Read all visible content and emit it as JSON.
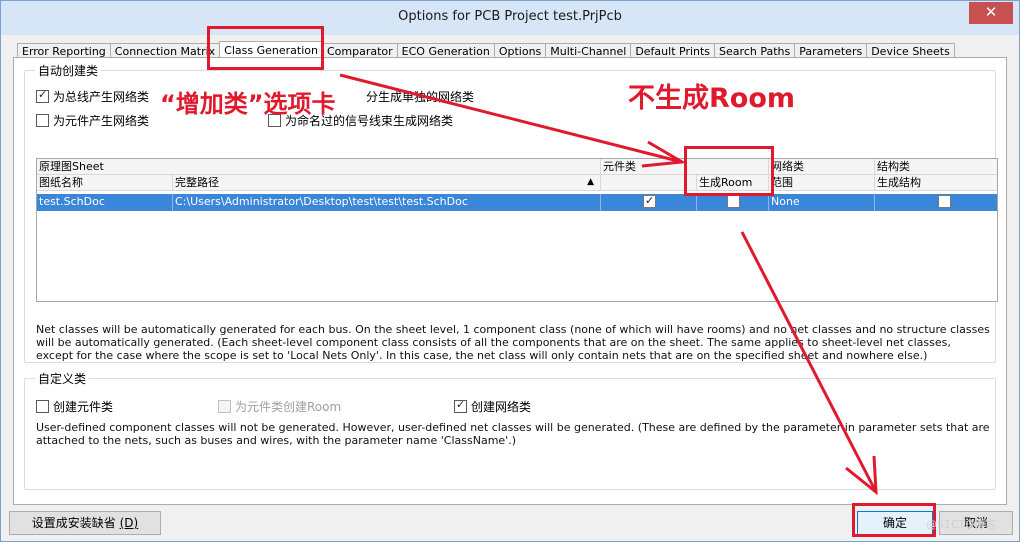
{
  "window": {
    "title": "Options for PCB Project test.PrjPcb",
    "close_glyph": "✕"
  },
  "tabs": [
    "Error Reporting",
    "Connection Matrix",
    "Class Generation",
    "Comparator",
    "ECO Generation",
    "Options",
    "Multi-Channel",
    "Default Prints",
    "Search Paths",
    "Parameters",
    "Device Sheets"
  ],
  "auto_group": {
    "title": "自动创建类",
    "cb_bus": "为总线产生网络类",
    "cb_bus_partial": "分生成单独的网络类",
    "cb_component": "为元件产生网络类",
    "cb_named": "为命名过的信号线束生成网络类",
    "grid": {
      "h1_sheet": "原理图Sheet",
      "h1_component_class": "元件类",
      "h1_net_class": "网络类",
      "h1_structure_class": "结构类",
      "h2_sheet_name": "图纸名称",
      "h2_full_path": "完整路径",
      "h2_sort_arrow": "▲",
      "h2_generate_room": "生成Room",
      "h2_scope": "范围",
      "h2_generate_structure": "生成结构",
      "row": {
        "sheet_name": "test.SchDoc",
        "full_path": "C:\\Users\\Administrator\\Desktop\\test\\test\\test.SchDoc",
        "scope": "None"
      }
    },
    "description": "Net classes will be automatically generated for each bus. On the sheet level, 1 component class (none of which will have rooms) and no net classes and no structure classes will be automatically generated. (Each sheet-level component class consists of all the components that are on the sheet. The same applies to sheet-level net classes, except for the case where the scope is set to 'Local Nets Only'. In this case, the net class will only contain nets that are on the specified sheet and nowhere else.)"
  },
  "custom_group": {
    "title": "自定义类",
    "cb_create_component": "创建元件类",
    "cb_create_room": "为元件类创建Room",
    "cb_create_net": "创建网络类",
    "description": "User-defined component classes will not be generated. However, user-defined net classes will be generated. (These are defined by the parameter in parameter sets that are attached to the nets, such as buses and wires, with the parameter name 'ClassName'.)"
  },
  "buttons": {
    "set_default": "设置成安装缺省",
    "set_default_key": "(D)",
    "ok": "确定",
    "cancel": "取消"
  },
  "annotations": {
    "add_class_tab": "“增加类”选项卡",
    "no_room": "不生成Room",
    "accent_color": "#e0192d"
  },
  "watermark": "@51CTO博客"
}
